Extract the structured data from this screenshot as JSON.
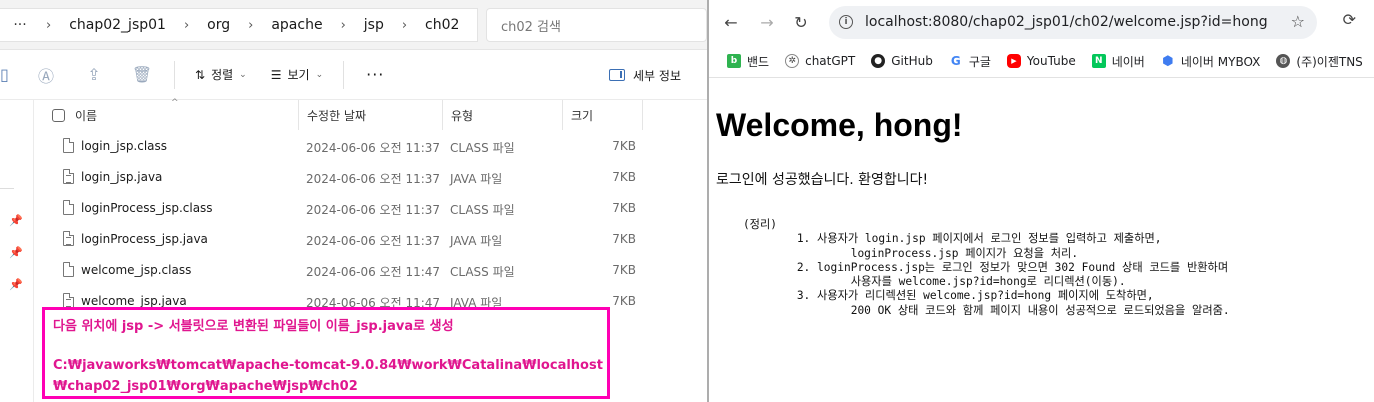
{
  "explorer": {
    "breadcrumb": [
      "chap02_jsp01",
      "org",
      "apache",
      "jsp",
      "ch02"
    ],
    "search_placeholder": "ch02 검색",
    "toolbar": {
      "sort_label": "정렬",
      "view_label": "보기",
      "more_label": "···",
      "details_label": "세부 정보"
    },
    "columns": {
      "name": "이름",
      "modified": "수정한 날짜",
      "type": "유형",
      "size": "크기"
    },
    "files": [
      {
        "name": "login_jsp.class",
        "modified": "2024-06-06 오전 11:37",
        "type": "CLASS 파일",
        "size": "7KB",
        "icon": "class-file-icon"
      },
      {
        "name": "login_jsp.java",
        "modified": "2024-06-06 오전 11:37",
        "type": "JAVA 파일",
        "size": "7KB",
        "icon": "java-file-icon"
      },
      {
        "name": "loginProcess_jsp.class",
        "modified": "2024-06-06 오전 11:37",
        "type": "CLASS 파일",
        "size": "7KB",
        "icon": "class-file-icon"
      },
      {
        "name": "loginProcess_jsp.java",
        "modified": "2024-06-06 오전 11:37",
        "type": "JAVA 파일",
        "size": "7KB",
        "icon": "java-file-icon"
      },
      {
        "name": "welcome_jsp.class",
        "modified": "2024-06-06 오전 11:47",
        "type": "CLASS 파일",
        "size": "7KB",
        "icon": "class-file-icon"
      },
      {
        "name": "welcome_jsp.java",
        "modified": "2024-06-06 오전 11:47",
        "type": "JAVA 파일",
        "size": "7KB",
        "icon": "java-file-icon"
      }
    ]
  },
  "annotation": {
    "line1": "다음 위치에 jsp -> 서블릿으로 변환된 파일들이 이름_jsp.java로 생성",
    "path_line1": "C:₩javaworks₩tomcat₩apache-tomcat-9.0.84₩work₩Catalina₩localhost",
    "path_line2": "₩chap02_jsp01₩org₩apache₩jsp₩ch02",
    "color": "#ff00b4"
  },
  "browser": {
    "url": "localhost:8080/chap02_jsp01/ch02/welcome.jsp?id=hong",
    "bookmarks": [
      {
        "label": "밴드",
        "icon": "band-icon",
        "color": "#2fb350"
      },
      {
        "label": "chatGPT",
        "icon": "chatgpt-icon",
        "color": "#444444"
      },
      {
        "label": "GitHub",
        "icon": "github-icon",
        "color": "#222222"
      },
      {
        "label": "구글",
        "icon": "google-icon",
        "color": "#4285f4"
      },
      {
        "label": "YouTube",
        "icon": "youtube-icon",
        "color": "#ff0000"
      },
      {
        "label": "네이버",
        "icon": "naver-icon",
        "color": "#03c75a"
      },
      {
        "label": "네이버 MYBOX",
        "icon": "mybox-icon",
        "color": "#3f7cf0"
      },
      {
        "label": "(주)이젠TNS",
        "icon": "globe-icon",
        "color": "#555555"
      }
    ],
    "page": {
      "heading": "Welcome, hong!",
      "message": "로그인에 성공했습니다. 환영합니다!",
      "notes": "    (정리)\n            1. 사용자가 login.jsp 페이지에서 로그인 정보를 입력하고 제출하면,\n                    loginProcess.jsp 페이지가 요청을 처리.\n            2. loginProcess.jsp는 로그인 정보가 맞으면 302 Found 상태 코드를 반환하며\n                    사용자를 welcome.jsp?id=hong로 리디렉션(이동).\n            3. 사용자가 리디렉션된 welcome.jsp?id=hong 페이지에 도착하면,\n                    200 OK 상태 코드와 함께 페이지 내용이 성공적으로 로드되었음을 알려줌."
    }
  }
}
